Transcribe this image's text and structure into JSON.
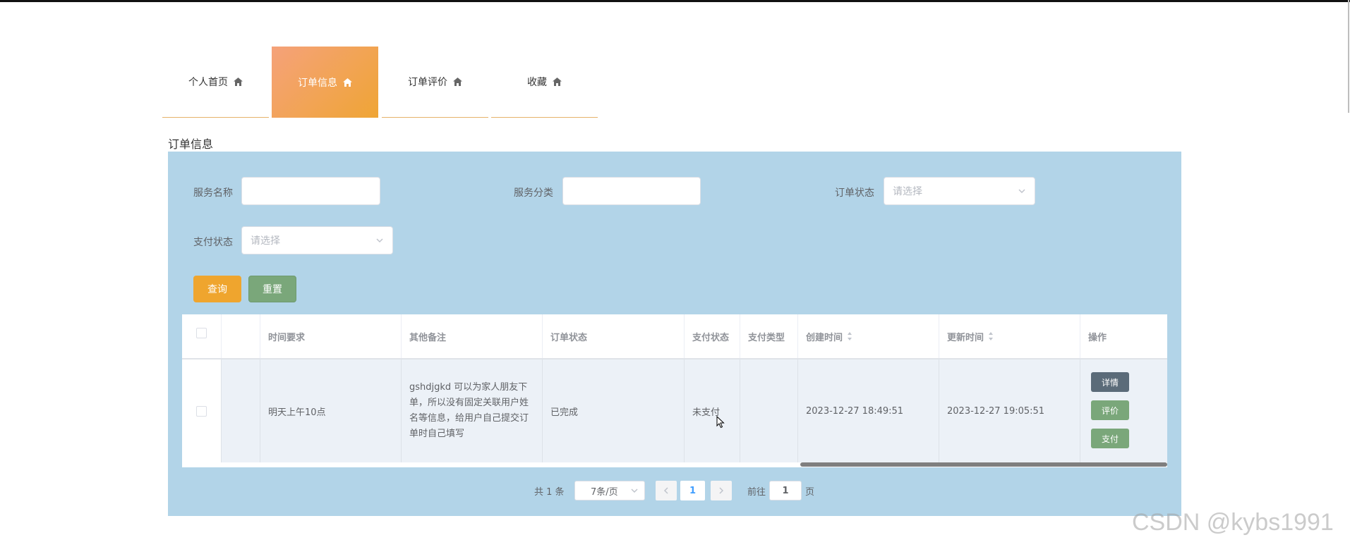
{
  "tabs": [
    {
      "label": "个人首页",
      "icon": "home-icon",
      "active": false
    },
    {
      "label": "订单信息",
      "icon": "home-icon",
      "active": true
    },
    {
      "label": "订单评价",
      "icon": "home-icon",
      "active": false
    },
    {
      "label": "收藏",
      "icon": "home-icon",
      "active": false
    }
  ],
  "section_title": "订单信息",
  "filters": {
    "service_name_label": "服务名称",
    "service_name_value": "",
    "service_category_label": "服务分类",
    "service_category_value": "",
    "order_status_label": "订单状态",
    "order_status_placeholder": "请选择",
    "pay_status_label": "支付状态",
    "pay_status_placeholder": "请选择"
  },
  "buttons": {
    "query": "查询",
    "reset": "重置"
  },
  "table": {
    "columns": [
      "时间要求",
      "其他备注",
      "订单状态",
      "支付状态",
      "支付类型",
      "创建时间",
      "更新时间",
      "操作"
    ],
    "rows": [
      {
        "time_req": "明天上午10点",
        "note": "gshdjgkd 可以为家人朋友下单，所以没有固定关联用户姓名等信息，给用户自己提交订单时自己填写",
        "order_status": "已完成",
        "pay_status": "未支付",
        "pay_type": "",
        "created": "2023-12-27 18:49:51",
        "updated": "2023-12-27 19:05:51",
        "actions": [
          "详情",
          "评价",
          "支付"
        ]
      }
    ]
  },
  "pagination": {
    "total": "共 1 条",
    "page_size": "7条/页",
    "current": "1",
    "goto_label": "前往",
    "goto_value": "1",
    "page_suffix": "页"
  },
  "watermark": "CSDN @kybs1991",
  "colors": {
    "accent": "#efa52e",
    "reset": "#7aa77a",
    "detail": "#5b6b79",
    "panel": "#b2d4e8"
  }
}
